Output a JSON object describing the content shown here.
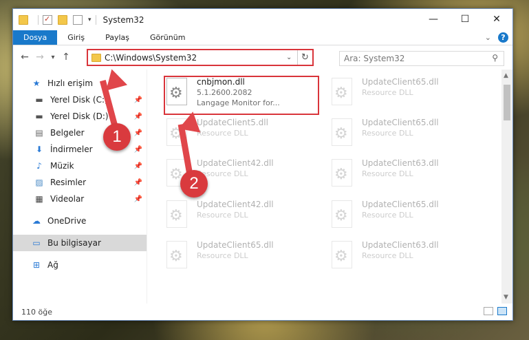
{
  "window": {
    "title": "System32",
    "controls": {
      "minimize": "—",
      "maximize": "☐",
      "close": "✕"
    }
  },
  "ribbon": {
    "tabs": [
      "Dosya",
      "Giriş",
      "Paylaş",
      "Görünüm"
    ],
    "help": "?"
  },
  "nav": {
    "back": "←",
    "forward": "→",
    "recent": "▾",
    "up": "↑",
    "address": "C:\\Windows\\System32",
    "search_placeholder": "Ara: System32"
  },
  "sidebar": {
    "quick_access": "Hızlı erişim",
    "items": [
      {
        "label": "Yerel Disk (C:)",
        "icon": "drive-icon"
      },
      {
        "label": "Yerel Disk (D:)",
        "icon": "drive-icon"
      },
      {
        "label": "Belgeler",
        "icon": "documents-icon"
      },
      {
        "label": "İndirmeler",
        "icon": "downloads-icon"
      },
      {
        "label": "Müzik",
        "icon": "music-icon"
      },
      {
        "label": "Resimler",
        "icon": "pictures-icon"
      },
      {
        "label": "Videolar",
        "icon": "videos-icon"
      }
    ],
    "onedrive": "OneDrive",
    "this_pc": "Bu bilgisayar",
    "network": "Ağ"
  },
  "files": [
    {
      "name": "cnbjmon.dll",
      "line2": "5.1.2600.2082",
      "line3": "Langage Monitor for...",
      "faded": false
    },
    {
      "name": "UpdateClient65.dll",
      "line2": "Resource DLL",
      "faded": true
    },
    {
      "name": "UpdateClient5.dll",
      "line2": "Resource DLL",
      "faded": true
    },
    {
      "name": "UpdateClient65.dll",
      "line2": "Resource DLL",
      "faded": true
    },
    {
      "name": "UpdateClient42.dll",
      "line2": "Resource DLL",
      "faded": true
    },
    {
      "name": "UpdateClient63.dll",
      "line2": "Resource DLL",
      "faded": true
    },
    {
      "name": "UpdateClient42.dll",
      "line2": "Resource DLL",
      "faded": true
    },
    {
      "name": "UpdateClient65.dll",
      "line2": "Resource DLL",
      "faded": true
    },
    {
      "name": "UpdateClient65.dll",
      "line2": "Resource DLL",
      "faded": true
    },
    {
      "name": "UpdateClient63.dll",
      "line2": "Resource DLL",
      "faded": true
    }
  ],
  "status": {
    "count": "110 öğe"
  },
  "annotations": {
    "step1": "1",
    "step2": "2",
    "color": "#d93a3e"
  }
}
